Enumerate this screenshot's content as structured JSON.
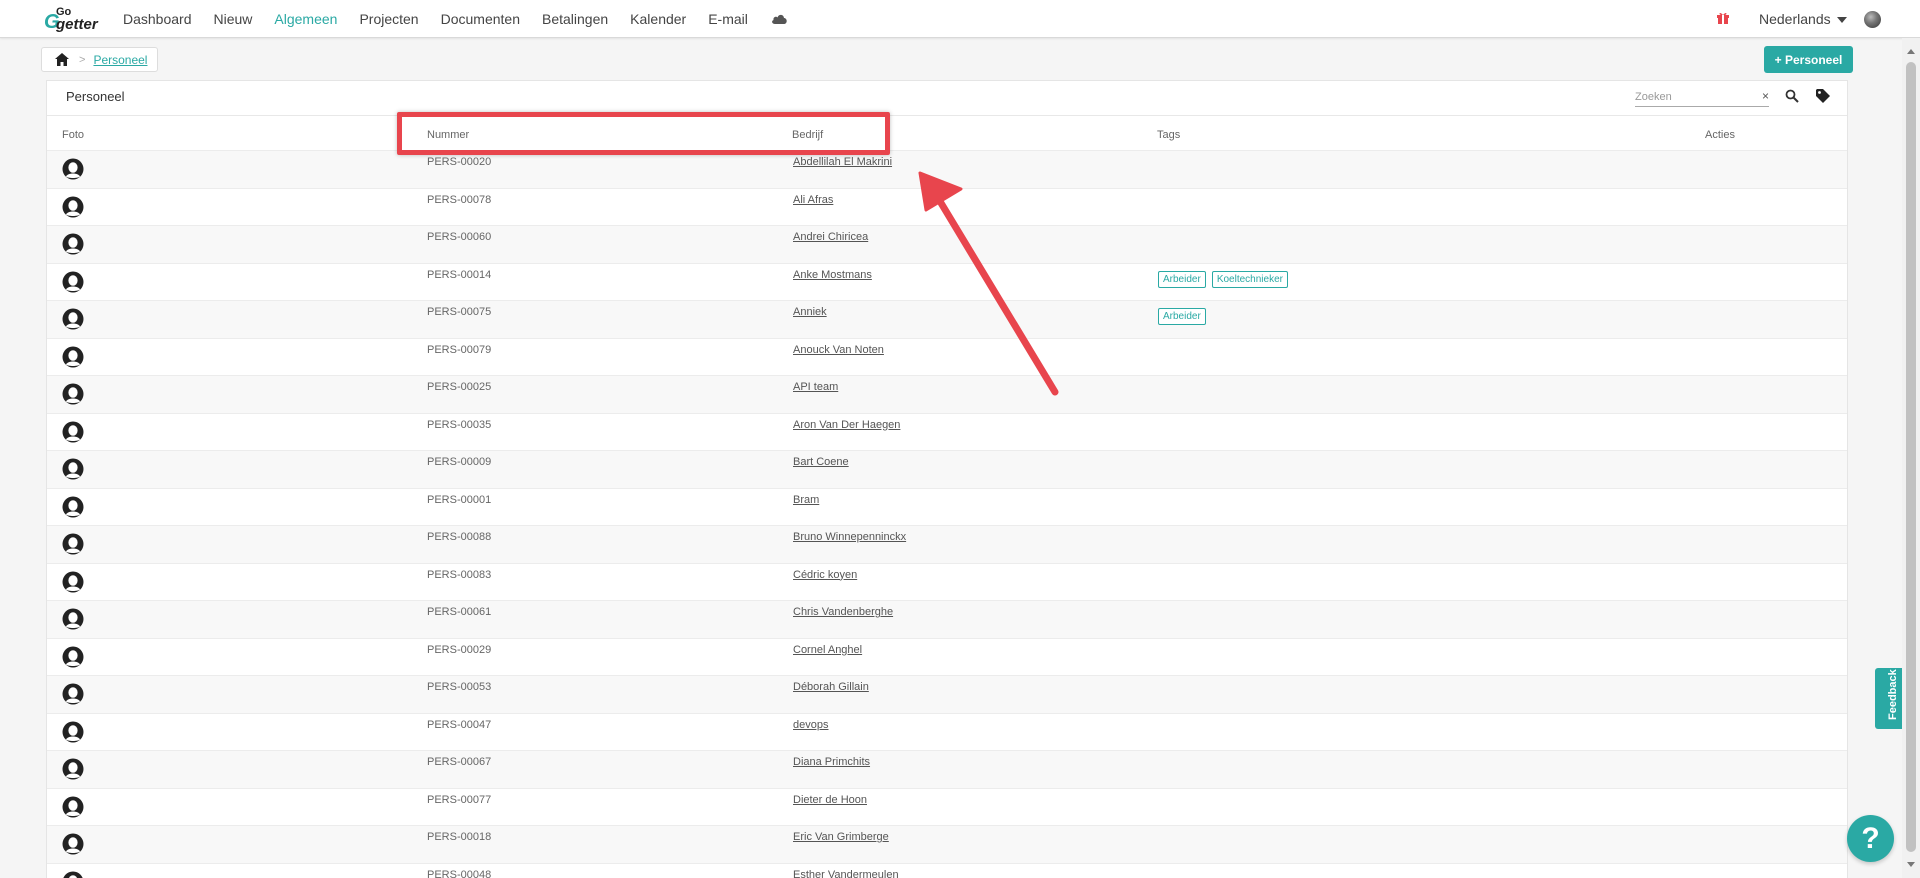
{
  "app": {
    "logo_small": "Go",
    "logo_g": "G",
    "logo_main": "getter"
  },
  "nav": {
    "items": [
      {
        "label": "Dashboard",
        "active": false
      },
      {
        "label": "Nieuw",
        "active": false
      },
      {
        "label": "Algemeen",
        "active": true
      },
      {
        "label": "Projecten",
        "active": false
      },
      {
        "label": "Documenten",
        "active": false
      },
      {
        "label": "Betalingen",
        "active": false
      },
      {
        "label": "Kalender",
        "active": false
      },
      {
        "label": "E-mail",
        "active": false
      }
    ],
    "language": "Nederlands"
  },
  "breadcrumb": {
    "current": "Personeel"
  },
  "toolbar": {
    "add_label": "+ Personeel"
  },
  "card": {
    "title": "Personeel",
    "search_placeholder": "Zoeken",
    "clear_label": "×"
  },
  "table": {
    "columns": [
      "Foto",
      "Nummer",
      "Bedrijf",
      "Tags",
      "Acties"
    ],
    "rows": [
      {
        "number": "PERS-00020",
        "name": "Abdellilah El Makrini",
        "tags": []
      },
      {
        "number": "PERS-00078",
        "name": "Ali Afras",
        "tags": []
      },
      {
        "number": "PERS-00060",
        "name": "Andrei Chiricea",
        "tags": []
      },
      {
        "number": "PERS-00014",
        "name": "Anke Mostmans",
        "tags": [
          "Arbeider",
          "Koeltechnieker"
        ]
      },
      {
        "number": "PERS-00075",
        "name": "Anniek",
        "tags": [
          "Arbeider"
        ]
      },
      {
        "number": "PERS-00079",
        "name": "Anouck Van Noten",
        "tags": []
      },
      {
        "number": "PERS-00025",
        "name": "API team",
        "tags": []
      },
      {
        "number": "PERS-00035",
        "name": "Aron Van Der Haegen",
        "tags": []
      },
      {
        "number": "PERS-00009",
        "name": "Bart Coene",
        "tags": []
      },
      {
        "number": "PERS-00001",
        "name": "Bram",
        "tags": []
      },
      {
        "number": "PERS-00088",
        "name": "Bruno Winnepenninckx",
        "tags": []
      },
      {
        "number": "PERS-00083",
        "name": "Cédric koyen",
        "tags": []
      },
      {
        "number": "PERS-00061",
        "name": "Chris Vandenberghe",
        "tags": []
      },
      {
        "number": "PERS-00029",
        "name": "Cornel Anghel",
        "tags": []
      },
      {
        "number": "PERS-00053",
        "name": "Déborah Gillain",
        "tags": []
      },
      {
        "number": "PERS-00047",
        "name": "devops",
        "tags": []
      },
      {
        "number": "PERS-00067",
        "name": "Diana Primchits",
        "tags": []
      },
      {
        "number": "PERS-00077",
        "name": "Dieter de Hoon",
        "tags": []
      },
      {
        "number": "PERS-00018",
        "name": "Eric Van Grimberge",
        "tags": []
      },
      {
        "number": "PERS-00048",
        "name": "Esther Vandermeulen",
        "tags": []
      }
    ]
  },
  "widgets": {
    "feedback_label": "Feedback",
    "help_label": "?"
  },
  "colors": {
    "accent": "#2aa9a4",
    "annotation": "#e8454d"
  }
}
